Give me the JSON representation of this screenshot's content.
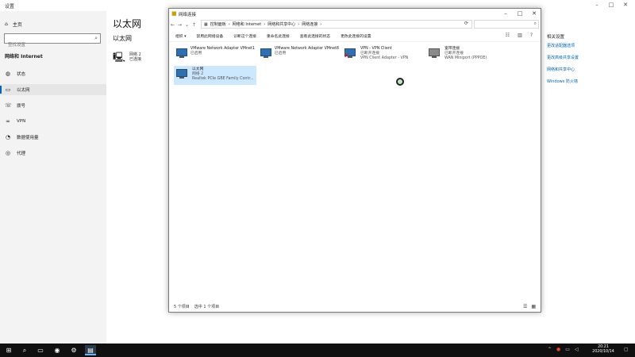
{
  "settings": {
    "window_title": "设置",
    "home_label": "主页",
    "search_placeholder": "查找设置",
    "section_title": "网络和 Internet",
    "nav_items": [
      {
        "label": "状态",
        "icon": "globe-icon"
      },
      {
        "label": "以太网",
        "icon": "ethernet-icon"
      },
      {
        "label": "拨号",
        "icon": "phone-icon"
      },
      {
        "label": "VPN",
        "icon": "vpn-icon"
      },
      {
        "label": "数据使用量",
        "icon": "data-usage-icon"
      },
      {
        "label": "代理",
        "icon": "proxy-icon"
      }
    ],
    "active_nav": "以太网",
    "heading": "以太网",
    "subheading": "以太网",
    "adapter": {
      "name": "网络 2",
      "status": "已连接"
    },
    "related": {
      "title": "相关设置",
      "links": [
        "更改适配器选项",
        "更改高级共享设置",
        "网络和共享中心",
        "Windows 防火墙"
      ]
    }
  },
  "explorer": {
    "title": "网络连接",
    "breadcrumb": [
      "控制面板",
      "网络和 Internet",
      "网络和共享中心",
      "网络连接"
    ],
    "commands": [
      "组织 ▾",
      "禁用此网络设备",
      "诊断这个连接",
      "重命名此连接",
      "查看此连接的状态",
      "更改此连接的设置"
    ],
    "adapters": [
      {
        "name": "VMware Network Adapter VMnet1",
        "status": "已启用",
        "device": "",
        "state": "enabled"
      },
      {
        "name": "VMware Network Adapter VMnet8",
        "status": "已启用",
        "device": "",
        "state": "enabled"
      },
      {
        "name": "VPN - VPN Client",
        "status": "已断开连接",
        "device": "VPN Client Adapter - VPN",
        "state": "disconnected"
      },
      {
        "name": "宽带连接",
        "status": "已断开连接",
        "device": "WAN Miniport (PPPOE)",
        "state": "dialup"
      },
      {
        "name": "以太网",
        "status": "网络 2",
        "device": "Realtek PCIe GBE Family Contr...",
        "state": "selected"
      }
    ],
    "status_items": "5 个项目",
    "status_selected": "选中 1 个项目"
  },
  "taskbar": {
    "time": "20:21",
    "date": "2020/10/14"
  },
  "colors": {
    "accent": "#0067c0",
    "link": "#0063b1",
    "selection": "#cce8ff",
    "taskbar": "#101010"
  }
}
